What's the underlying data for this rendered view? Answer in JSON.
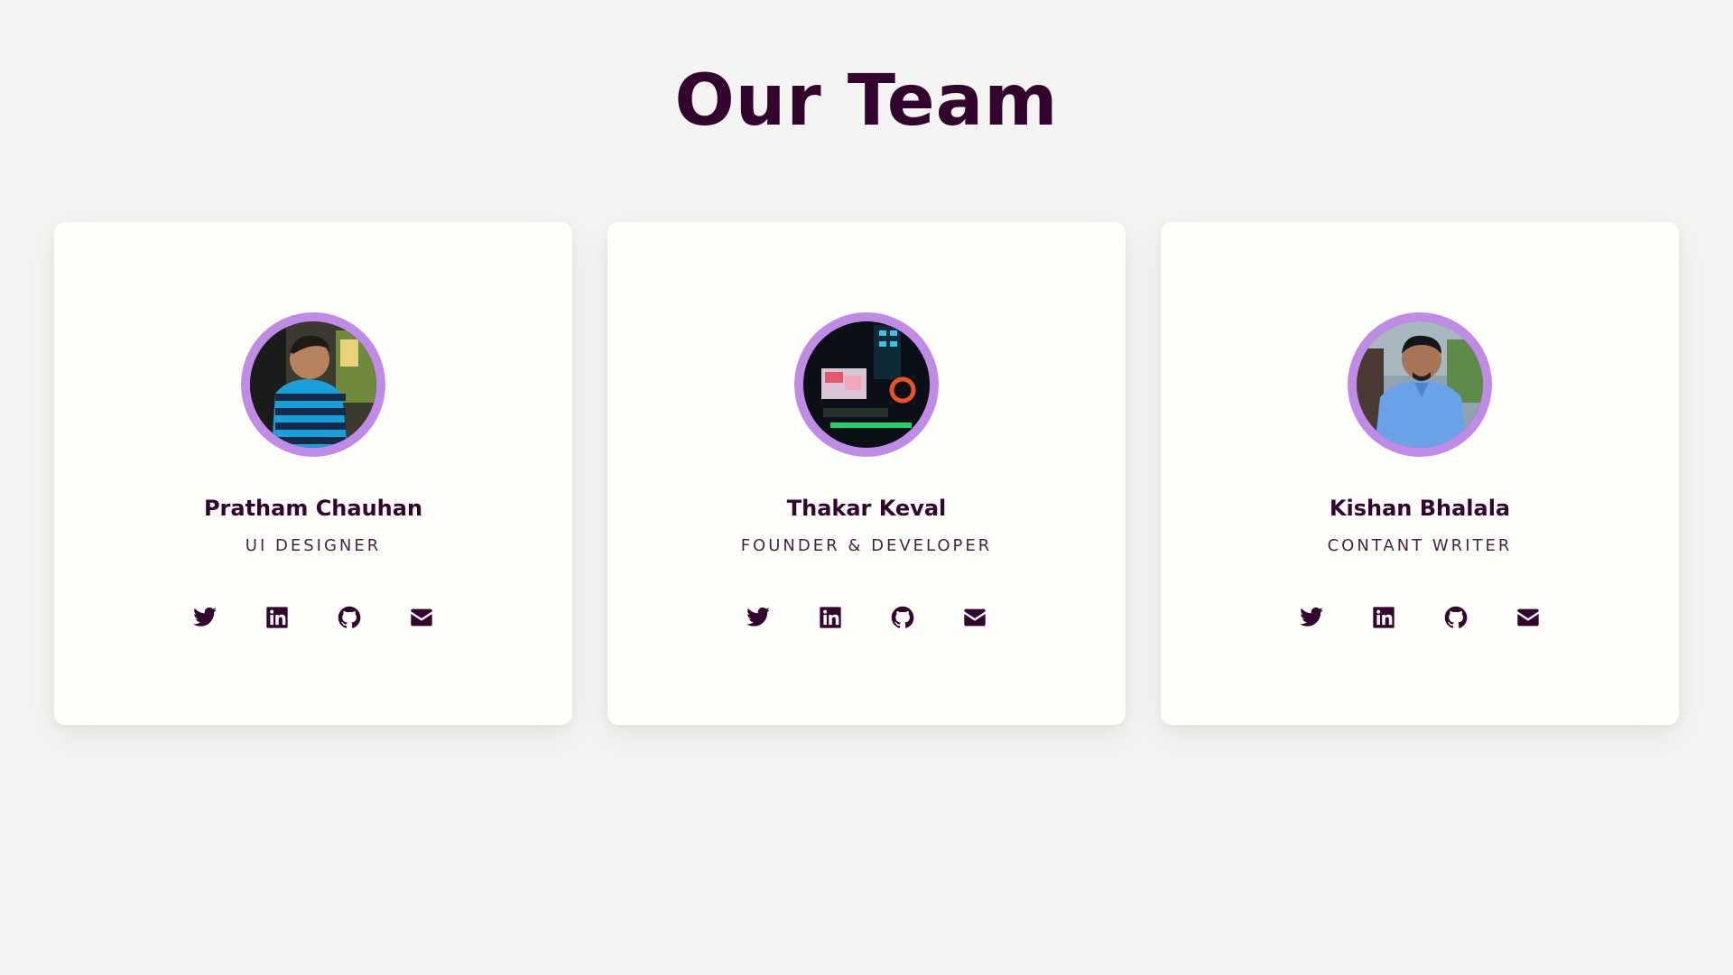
{
  "page": {
    "title": "Our Team"
  },
  "colors": {
    "title": "#33042e",
    "accent_ring": "#c08be6",
    "card_background": "#fefefb",
    "page_background": "#f4f4f2"
  },
  "team": [
    {
      "name": "Pratham Chauhan",
      "role": "UI DESIGNER",
      "socials": [
        "twitter-icon",
        "linkedin-icon",
        "github-icon",
        "email-icon"
      ]
    },
    {
      "name": "Thakar Keval",
      "role": "FOUNDER & DEVELOPER",
      "socials": [
        "twitter-icon",
        "linkedin-icon",
        "github-icon",
        "email-icon"
      ]
    },
    {
      "name": "Kishan Bhalala",
      "role": "CONTANT WRITER",
      "socials": [
        "twitter-icon",
        "linkedin-icon",
        "github-icon",
        "email-icon"
      ]
    }
  ]
}
